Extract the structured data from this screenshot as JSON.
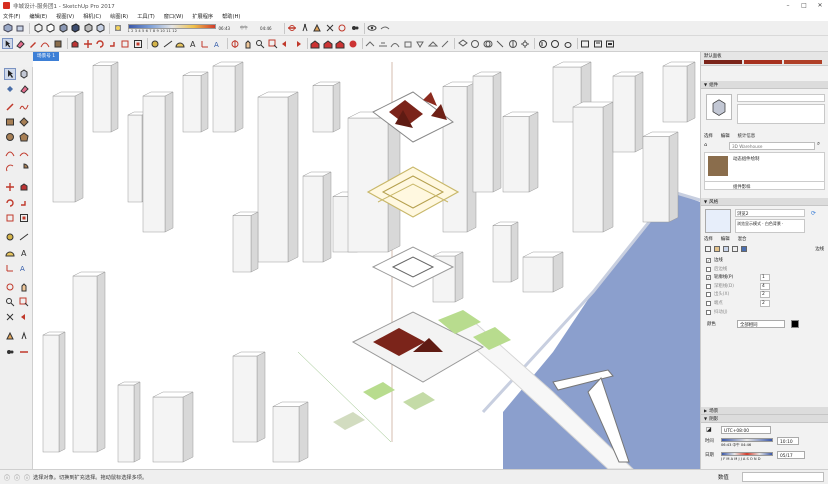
{
  "window": {
    "title": "非城设计-服务团1 - SketchUp Pro 2017",
    "controls": [
      "–",
      "□",
      "✕"
    ]
  },
  "menus": [
    "文件(F)",
    "编辑(E)",
    "视图(V)",
    "相机(C)",
    "绘图(R)",
    "工具(T)",
    "窗口(W)",
    "扩展程序",
    "帮助(H)"
  ],
  "shadow_bar": {
    "scale": "1 2 3 4 5 6 7 8 9 10 11 12",
    "time_start": "06:43",
    "time_mid": "中午",
    "time_end": "04:46"
  },
  "scene_tab": "场景号 1",
  "tray": {
    "default_tray_label": "默认面板",
    "components": {
      "header": "组件",
      "tab_select": "选择",
      "tab_edit": "编辑",
      "tab_stats": "统计信息",
      "search_placeholder": "3D Warehouse",
      "item_name": "动态组件绘制",
      "item_name2": "组件影样"
    },
    "styles": {
      "header": "风格",
      "style_name": "浏览2",
      "style_desc": "浏览显示模式 · 白色背景 ·",
      "tab_select": "选择",
      "tab_edit": "编辑",
      "tab_mix": "混合",
      "right_label": "边线",
      "options": [
        {
          "label": "边线",
          "checked": true
        },
        {
          "label": "后边线",
          "checked": false
        },
        {
          "label": "轮廓线(P)",
          "checked": true,
          "value": "1"
        },
        {
          "label": "深粗线(D)",
          "checked": false,
          "value": "4"
        },
        {
          "label": "出头(X)",
          "checked": false,
          "value": "2"
        },
        {
          "label": "端点",
          "checked": false,
          "value": "2"
        },
        {
          "label": "抖动(J)",
          "checked": false
        }
      ],
      "color_label": "颜色",
      "color_value": "全部相同"
    },
    "scenes_header": "场景",
    "shadows": {
      "header": "阴影",
      "timezone": "UTC+08:00",
      "time_label": "时间",
      "date_label": "日期",
      "time_value": "10:10",
      "date_value": "05/17",
      "time_ticks": "06:43 中午 04:46",
      "date_ticks": "J F M A M J J A S O N D"
    }
  },
  "status": {
    "text": "选择对象。切换到扩充选择。拖动鼠标选择多项。",
    "measurement_label": "数值"
  },
  "colors": {
    "water": "#8b9fcd",
    "accent_red": "#7b241a",
    "green_roof": "#b8dc8e",
    "selection_yellow": "#d8d2a0",
    "scene_tab": "#3d7fd6"
  }
}
